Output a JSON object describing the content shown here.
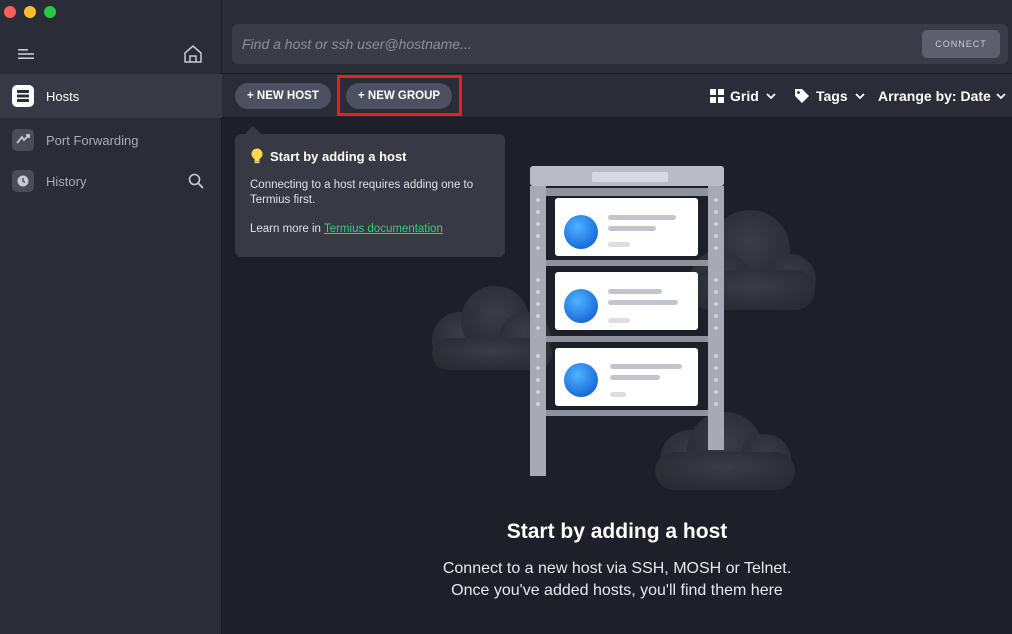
{
  "sidebar": {
    "items": [
      {
        "label": "Hosts",
        "icon": "hosts-icon",
        "active": true
      },
      {
        "label": "Port Forwarding",
        "icon": "port-forwarding-icon",
        "active": false
      },
      {
        "label": "History",
        "icon": "history-icon",
        "active": false
      }
    ]
  },
  "search": {
    "placeholder": "Find a host or ssh user@hostname...",
    "value": "",
    "connect_label": "CONNECT"
  },
  "toolbar": {
    "new_host_label": "+ NEW HOST",
    "new_group_label": "+ NEW GROUP",
    "view_label": "Grid",
    "tags_label": "Tags",
    "arrange_label": "Arrange by: Date"
  },
  "tip": {
    "title": "Start by adding a host",
    "body": "Connecting to a host requires adding one to Termius first.",
    "learn_more_prefix": "Learn more in ",
    "link_text": "Termius documentation"
  },
  "empty_state": {
    "title": "Start by adding a host",
    "line1": "Connect to a new host via SSH, MOSH or Telnet.",
    "line2": "Once you've added hosts, you'll find them here"
  },
  "colors": {
    "accent_link": "#2bd66e",
    "highlight_box": "#e8211b",
    "globe": "#1f7fe0"
  }
}
